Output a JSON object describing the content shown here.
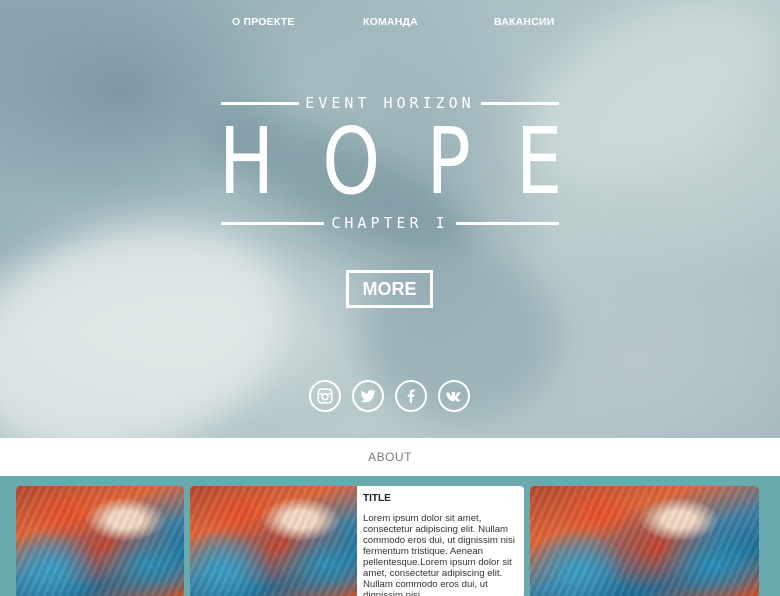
{
  "nav": {
    "items": [
      {
        "label": "О ПРОЕКТЕ"
      },
      {
        "label": "КОМАНДА"
      },
      {
        "label": "ВАКАНСИИ"
      }
    ]
  },
  "hero": {
    "kicker": "EVENT HORIZON",
    "title_letters": [
      "H",
      "O",
      "P",
      "E"
    ],
    "chapter": "CHAPTER I",
    "more_label": "MORE"
  },
  "social": {
    "icons": [
      "instagram-icon",
      "twitter-icon",
      "facebook-icon",
      "vk-icon"
    ]
  },
  "about": {
    "label": "ABOUT"
  },
  "card": {
    "title": "TITLE",
    "body": "Lorem ipsum dolor sit amet, consectetur adipiscing elit. Nullam commodo eros dui, ut dignissim nisi fermentum tristique. Aenean pellentesque.Lorem ipsum dolor sit amet, consectetur adipiscing elit. Nullam commodo eros dui, ut dignissim nisi"
  },
  "colors": {
    "accent_teal": "#6aa9ae",
    "white": "#ffffff",
    "about_text": "#7a7a7a"
  }
}
